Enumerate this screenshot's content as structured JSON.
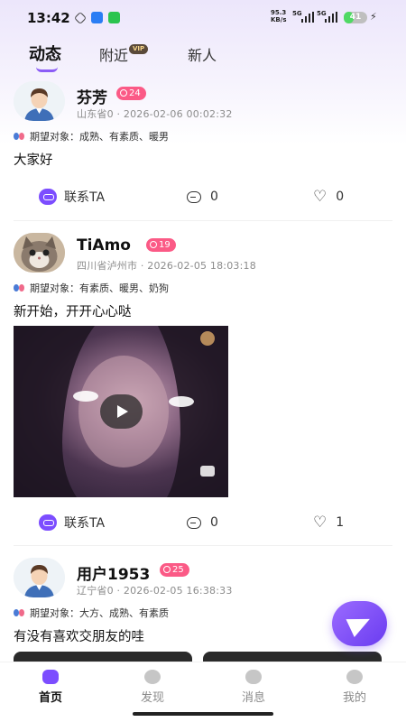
{
  "status_bar": {
    "time": "13:42",
    "net_speed_value": "95.3",
    "net_speed_unit": "KB/s",
    "signal1_label": "5G",
    "signal2_label": "5G",
    "battery_level": "41",
    "battery_fraction": 0.41
  },
  "tabs": [
    {
      "label": "动态",
      "active": true
    },
    {
      "label": "附近",
      "badge": "VIP"
    },
    {
      "label": "新人"
    }
  ],
  "posts": [
    {
      "username": "芬芳",
      "level": "24",
      "meta": "山东省0 · 2026-02-06 00:02:32",
      "expect": "期望对象：成熟、有素质、暖男",
      "text": "大家好",
      "contact_label": "联系TA",
      "comments": "0",
      "likes": "0"
    },
    {
      "username": "TiAmo",
      "level": "19",
      "meta": "四川省泸州市 · 2026-02-05 18:03:18",
      "expect": "期望对象：有素质、暖男、奶狗",
      "text": "新开始，开开心心哒",
      "contact_label": "联系TA",
      "comments": "0",
      "likes": "1"
    },
    {
      "username": "用户1953",
      "level": "25",
      "meta": "辽宁省0 · 2026-02-05 16:38:33",
      "expect": "期望对象：大方、成熟、有素质",
      "text": "有没有喜欢交朋友的哇"
    }
  ],
  "bottom_nav": [
    {
      "label": "首页",
      "icon": "home-icon",
      "active": true
    },
    {
      "label": "发现",
      "icon": "discover-icon"
    },
    {
      "label": "消息",
      "icon": "message-icon"
    },
    {
      "label": "我的",
      "icon": "profile-icon"
    }
  ],
  "colors": {
    "accent": "#7c4dff",
    "level_badge": "#fb5a86"
  }
}
